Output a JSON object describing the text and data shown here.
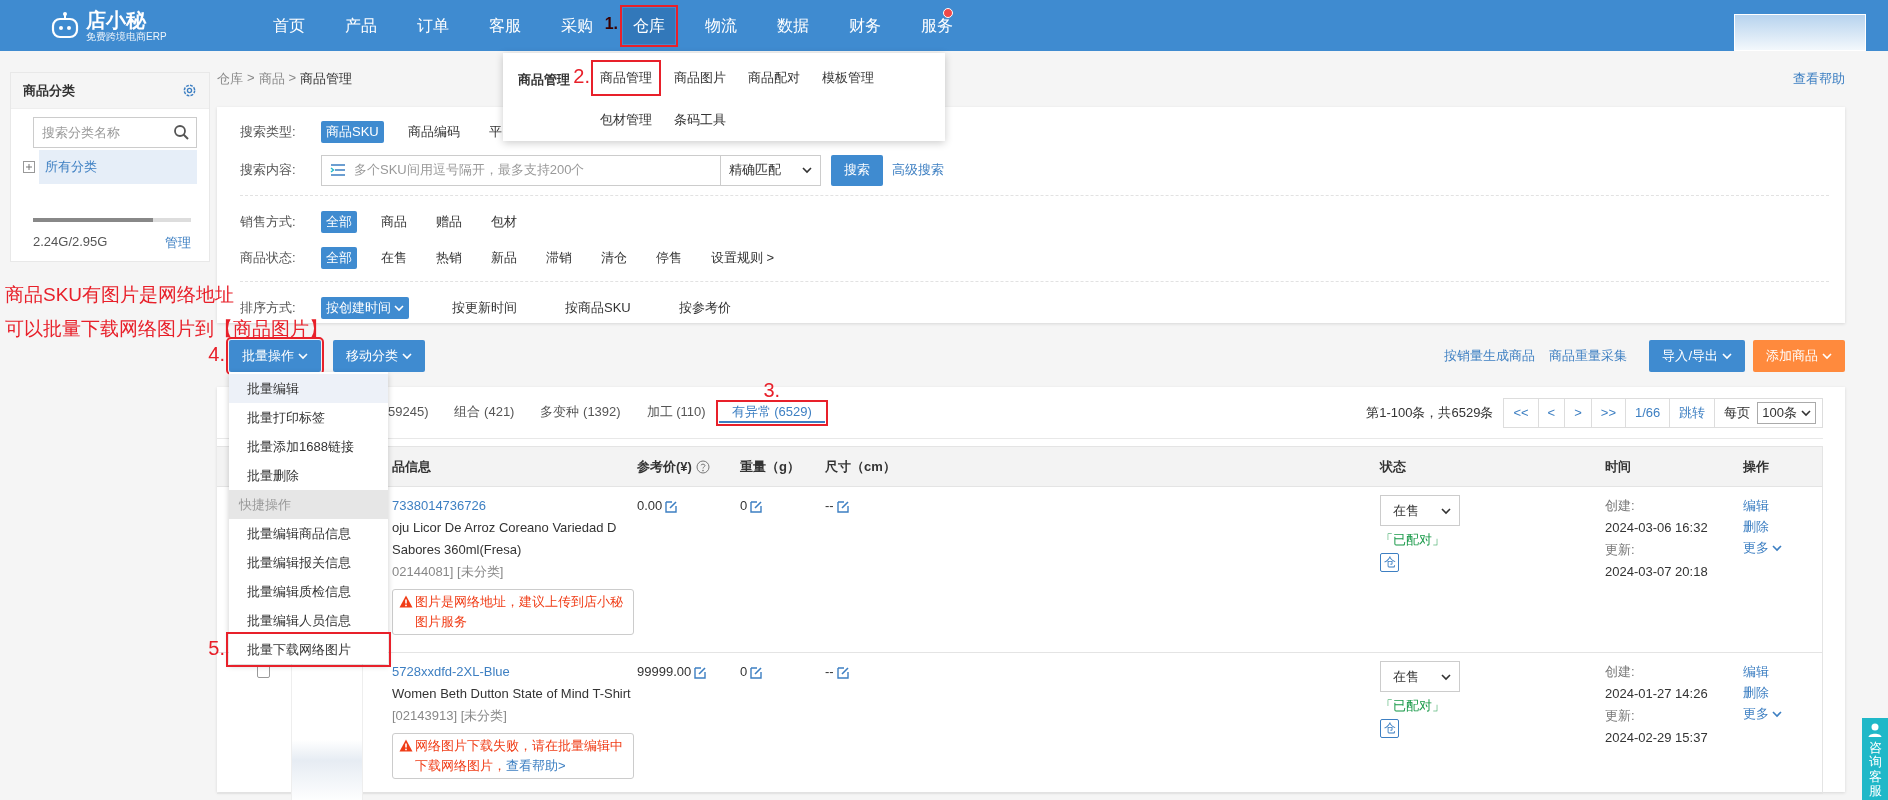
{
  "nav": {
    "logo": {
      "name": "店小秘",
      "tagline": "免费跨境电商ERP"
    },
    "items": [
      {
        "label": "首页",
        "selected": false
      },
      {
        "label": "产品",
        "selected": false
      },
      {
        "label": "订单",
        "selected": false
      },
      {
        "label": "客服",
        "selected": false
      },
      {
        "label": "采购",
        "selected": false
      },
      {
        "label": "仓库",
        "selected": true,
        "annotated": true,
        "marker": "1."
      },
      {
        "label": "物流",
        "selected": false
      },
      {
        "label": "数据",
        "selected": false
      },
      {
        "label": "财务",
        "selected": false
      },
      {
        "label": "服务",
        "selected": false,
        "dot": true
      }
    ]
  },
  "submenu": {
    "group_label": "商品管理",
    "items": [
      {
        "label": "商品管理",
        "annotated": true,
        "marker": "2."
      },
      {
        "label": "商品图片"
      },
      {
        "label": "商品配对"
      },
      {
        "label": "模板管理"
      },
      {
        "label": "包材管理"
      },
      {
        "label": "条码工具"
      }
    ]
  },
  "sidebar": {
    "title": "商品分类",
    "search": {
      "placeholder": "搜索分类名称"
    },
    "tree": [
      {
        "label": "所有分类",
        "selected": true
      }
    ],
    "storage": {
      "level": 0.76,
      "text": "2.24G/2.95G",
      "link": "管理"
    }
  },
  "breadcrumb": {
    "items": [
      "仓库",
      "商品",
      "商品管理"
    ],
    "separator": ">"
  },
  "help_link": "查看帮助",
  "filters": {
    "groups": [
      [
        {
          "kind": "options",
          "label": "搜索类型:",
          "options": [
            {
              "label": "商品SKU",
              "selected": true
            },
            {
              "label": "商品编码",
              "selected": false
            },
            {
              "label": "平",
              "selected": false
            }
          ]
        },
        {
          "kind": "search",
          "label": "搜索内容:",
          "placeholder": "多个SKU间用逗号隔开，最多支持200个",
          "match": "精确匹配",
          "button": "搜索",
          "link": "高级搜索"
        }
      ],
      [
        {
          "kind": "options",
          "label": "销售方式:",
          "options": [
            {
              "label": "全部",
              "selected": true
            },
            {
              "label": "商品",
              "selected": false
            },
            {
              "label": "赠品",
              "selected": false
            },
            {
              "label": "包材",
              "selected": false
            }
          ]
        },
        {
          "kind": "options",
          "label": "商品状态:",
          "options": [
            {
              "label": "全部",
              "selected": true
            },
            {
              "label": "在售",
              "selected": false
            },
            {
              "label": "热销",
              "selected": false
            },
            {
              "label": "新品",
              "selected": false
            },
            {
              "label": "滞销",
              "selected": false
            },
            {
              "label": "清仓",
              "selected": false
            },
            {
              "label": "停售",
              "selected": false
            },
            {
              "label": "设置规则 >",
              "selected": false
            }
          ]
        }
      ],
      [
        {
          "kind": "sort",
          "label": "排序方式:",
          "options": [
            {
              "label": "按创建时间",
              "selected": true,
              "caret": true
            },
            {
              "label": "按更新时间",
              "selected": false
            },
            {
              "label": "按商品SKU",
              "selected": false
            },
            {
              "label": "按参考价",
              "selected": false
            }
          ]
        }
      ]
    ]
  },
  "annotation_note": [
    "商品SKU有图片是网络地址",
    "可以批量下载网络图片到【商品图片】"
  ],
  "toolbar": {
    "left": [
      {
        "label": "批量操作",
        "annotated": true,
        "marker": "4.",
        "menu": true
      },
      {
        "label": "移动分类"
      }
    ],
    "links": [
      "按销量生成商品",
      "商品重量采集"
    ],
    "buttons": [
      {
        "label": "导入/导出",
        "kind": "primary"
      },
      {
        "label": "添加商品",
        "kind": "warning"
      }
    ]
  },
  "batch_menu": [
    {
      "kind": "item",
      "label": "批量编辑",
      "selected": true
    },
    {
      "kind": "item",
      "label": "批量打印标签",
      "selected": false
    },
    {
      "kind": "item",
      "label": "批量添加1688链接",
      "selected": false
    },
    {
      "kind": "item",
      "label": "批量删除",
      "selected": false
    },
    {
      "kind": "header",
      "label": "快捷操作"
    },
    {
      "kind": "item",
      "label": "批量编辑商品信息",
      "selected": false
    },
    {
      "kind": "item",
      "label": "批量编辑报关信息",
      "selected": false
    },
    {
      "kind": "item",
      "label": "批量编辑质检信息",
      "selected": false
    },
    {
      "kind": "item",
      "label": "批量编辑人员信息",
      "selected": false
    },
    {
      "kind": "item",
      "label": "批量下载网络图片",
      "selected": false,
      "annotated": true,
      "marker": "5."
    }
  ],
  "tabs": [
    {
      "label": "59245)",
      "selected": false
    },
    {
      "label": "组合 (421)",
      "selected": false
    },
    {
      "label": "多变种 (1392)",
      "selected": false
    },
    {
      "label": "加工 (110)",
      "selected": false
    },
    {
      "label": "有异常 (6529)",
      "selected": true,
      "annotated": true,
      "marker": "3."
    }
  ],
  "pagination": {
    "summary": "第1-100条，共6529条",
    "buttons": [
      "<<",
      "<",
      ">",
      ">>"
    ],
    "page": "1/66",
    "jump": "跳转",
    "per_page_label": "每页",
    "per_page": "100条"
  },
  "table": {
    "columns": [
      {
        "label": "品信息"
      },
      {
        "label": "参考价(¥)",
        "help": true
      },
      {
        "label": "重量（g）"
      },
      {
        "label": "尺寸（cm）"
      },
      {
        "label": "状态"
      },
      {
        "label": "时间"
      },
      {
        "label": "操作"
      }
    ],
    "rows": [
      {
        "sku": "7338014736726",
        "title_lines": [
          "oju Licor De Arroz Coreano Variedad D",
          "Sabores 360ml(Fresa)"
        ],
        "code": "02144081] [未分类]",
        "warning": {
          "text": "图片是网络地址，建议上传到店小秘图片服务"
        },
        "price": "0.00",
        "weight": "0",
        "size": "--",
        "status": "在售",
        "pair": "「已配对」",
        "warehouse": "仓",
        "created_label": "创建:",
        "created": "2024-03-06 16:32",
        "updated_label": "更新:",
        "updated": "2024-03-07 20:18",
        "actions": [
          {
            "label": "编辑",
            "kind": "link"
          },
          {
            "label": "删除",
            "kind": "link"
          },
          {
            "label": "更多",
            "kind": "dropdown"
          }
        ]
      },
      {
        "checked": false,
        "has_photo": true,
        "sku": "5728xxdfd-2XL-Blue",
        "title_lines": [
          "Women Beth Dutton State of Mind T-Shirt"
        ],
        "code": "[02143913] [未分类]",
        "warning": {
          "text": "网络图片下载失败，请在批量编辑中下载网络图片，",
          "link": "查看帮助>"
        },
        "price": "99999.00",
        "weight": "0",
        "size": "--",
        "status": "在售",
        "pair": "「已配对」",
        "warehouse": "仓",
        "created_label": "创建:",
        "created": "2024-01-27 14:26",
        "updated_label": "更新:",
        "updated": "2024-02-29 15:37",
        "actions": [
          {
            "label": "编辑",
            "kind": "link"
          },
          {
            "label": "删除",
            "kind": "link"
          },
          {
            "label": "更多",
            "kind": "dropdown"
          }
        ]
      }
    ]
  },
  "consult_button": "咨询客服"
}
